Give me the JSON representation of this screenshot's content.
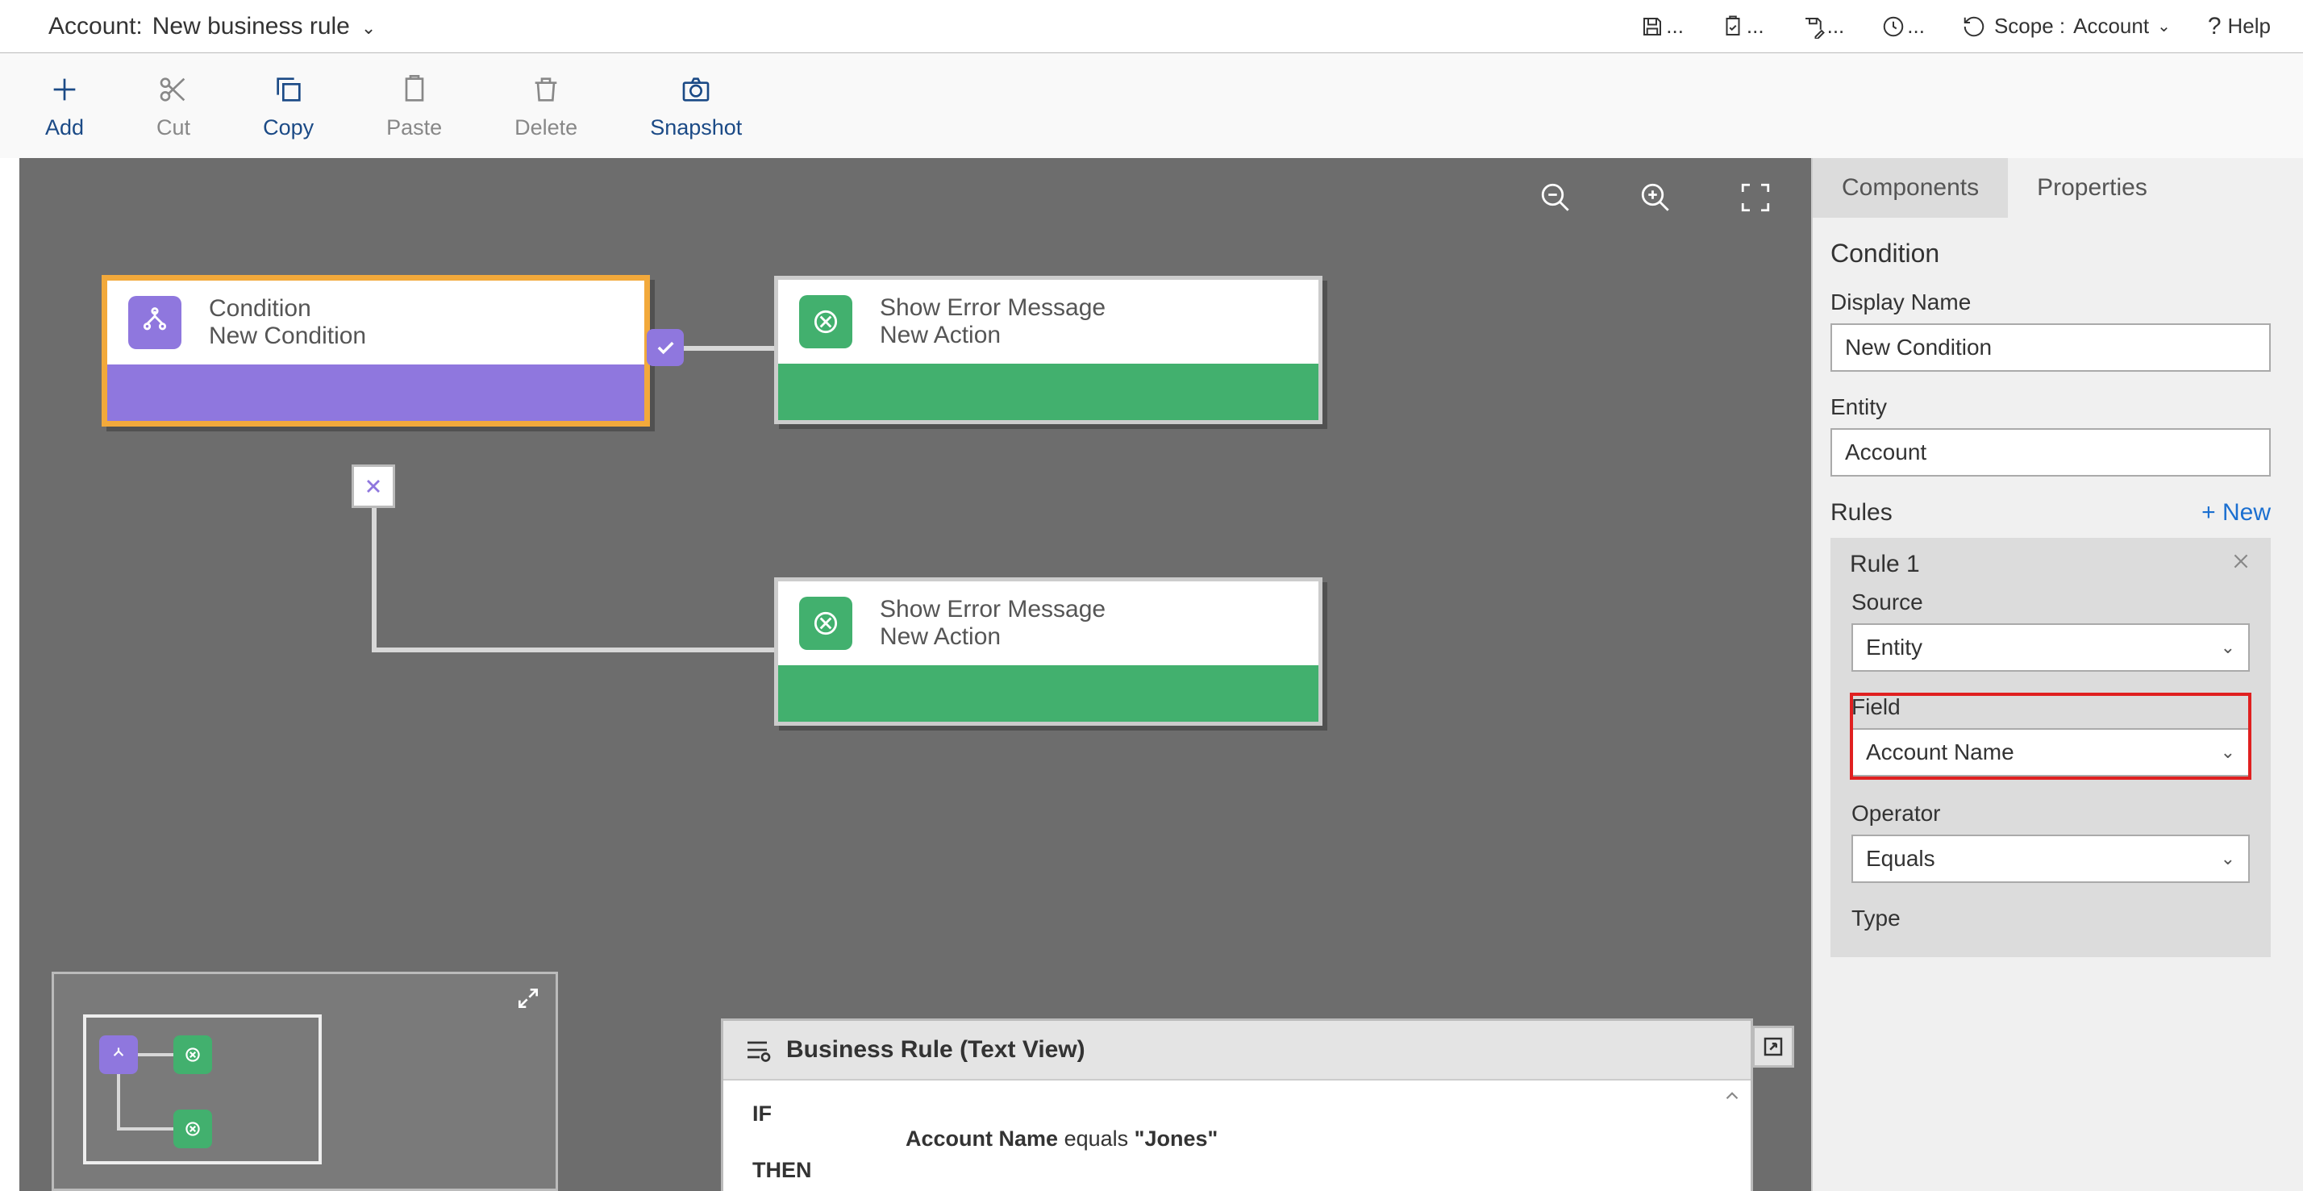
{
  "topbar": {
    "title_label": "Account:",
    "title_name": "New business rule",
    "scope_label": "Scope :",
    "scope_value": "Account",
    "help_label": "Help"
  },
  "toolbar": {
    "add": "Add",
    "cut": "Cut",
    "copy": "Copy",
    "paste": "Paste",
    "delete": "Delete",
    "snapshot": "Snapshot"
  },
  "nodes": {
    "condition": {
      "title": "Condition",
      "subtitle": "New Condition"
    },
    "action1": {
      "title": "Show Error Message",
      "subtitle": "New Action"
    },
    "action2": {
      "title": "Show Error Message",
      "subtitle": "New Action"
    }
  },
  "textview": {
    "title": "Business Rule (Text View)",
    "if": "IF",
    "then": "THEN",
    "stmt_field": "Account Name",
    "stmt_op": "equals",
    "stmt_val": "\"Jones\""
  },
  "panel": {
    "tab_components": "Components",
    "tab_properties": "Properties",
    "section_title": "Condition",
    "display_name_label": "Display Name",
    "display_name_value": "New Condition",
    "entity_label": "Entity",
    "entity_value": "Account",
    "rules_label": "Rules",
    "new_label": "+  New",
    "rule1_title": "Rule 1",
    "source_label": "Source",
    "source_value": "Entity",
    "field_label": "Field",
    "field_value": "Account Name",
    "operator_label": "Operator",
    "operator_value": "Equals",
    "type_label": "Type"
  }
}
